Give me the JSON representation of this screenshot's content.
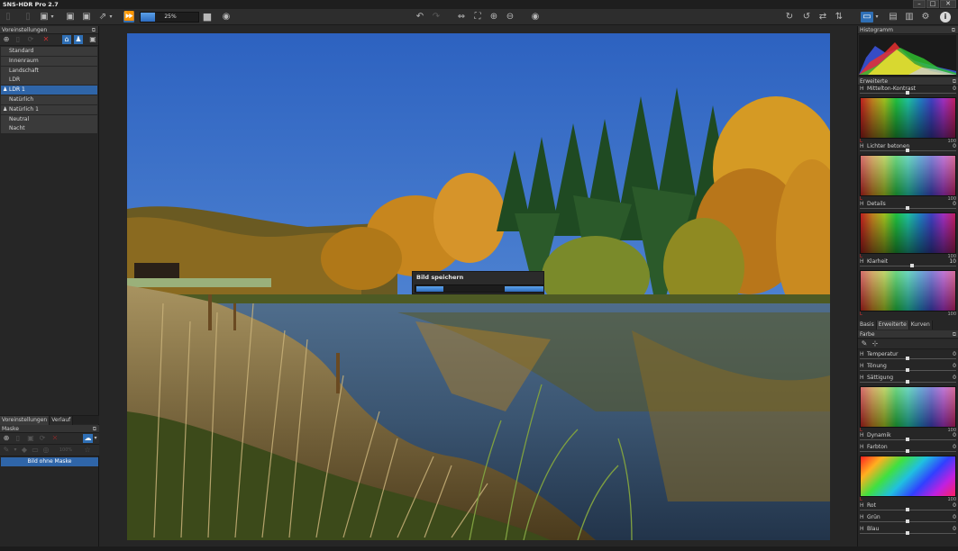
{
  "window": {
    "title": "SNS-HDR Pro 2.7"
  },
  "toolbar": {
    "zoom_value": "25%",
    "zoom_fraction": 0.25
  },
  "left": {
    "presets_title": "Voreinstellungen",
    "presets": [
      {
        "label": "Standard",
        "selected": false,
        "user": false
      },
      {
        "label": "Innenraum",
        "selected": false,
        "user": false
      },
      {
        "label": "Landschaft",
        "selected": false,
        "user": false
      },
      {
        "label": "LDR",
        "selected": false,
        "user": false
      },
      {
        "label": "LDR 1",
        "selected": true,
        "user": true
      },
      {
        "label": "Natürlich",
        "selected": false,
        "user": false
      },
      {
        "label": "Natürlich 1",
        "selected": false,
        "user": true
      },
      {
        "label": "Neutral",
        "selected": false,
        "user": false
      },
      {
        "label": "Nacht",
        "selected": false,
        "user": false
      }
    ],
    "bottom_tabs": [
      "Voreinstellungen",
      "Verlauf"
    ],
    "mask_title": "Maske",
    "mask_zoom": "100%",
    "mask_item": "Bild ohne Maske"
  },
  "dialog": {
    "title": "Bild speichern"
  },
  "right": {
    "histogram_title": "Histogramm",
    "advanced_title": "Erweiterte",
    "advanced": [
      {
        "label": "Mittelton-Kontrast",
        "value": "0",
        "level": 0.5
      },
      {
        "label": "Lichter betonen",
        "value": "0",
        "level": 0.5
      },
      {
        "label": "Details",
        "value": "0",
        "level": 0.5
      },
      {
        "label": "Klarheit",
        "value": "10",
        "level": 0.55
      }
    ],
    "grad_min": "L",
    "grad_max": "100",
    "tabs": [
      "Basis",
      "Erweiterte",
      "Kurven"
    ],
    "color_title": "Farbe",
    "color": [
      {
        "label": "Temperatur",
        "value": "0",
        "level": 0.5
      },
      {
        "label": "Tönung",
        "value": "0",
        "level": 0.5
      },
      {
        "label": "Sättigung",
        "value": "0",
        "level": 0.5
      },
      {
        "label": "Dynamik",
        "value": "0",
        "level": 0.5
      },
      {
        "label": "Farbton",
        "value": "0",
        "level": 0.5
      },
      {
        "label": "Rot",
        "value": "0",
        "level": 0.5
      },
      {
        "label": "Grün",
        "value": "0",
        "level": 0.5
      },
      {
        "label": "Blau",
        "value": "0",
        "level": 0.5
      }
    ]
  },
  "colors": {
    "accent": "#2f6fb5",
    "panel": "#262626",
    "item": "#3a3a3a"
  }
}
